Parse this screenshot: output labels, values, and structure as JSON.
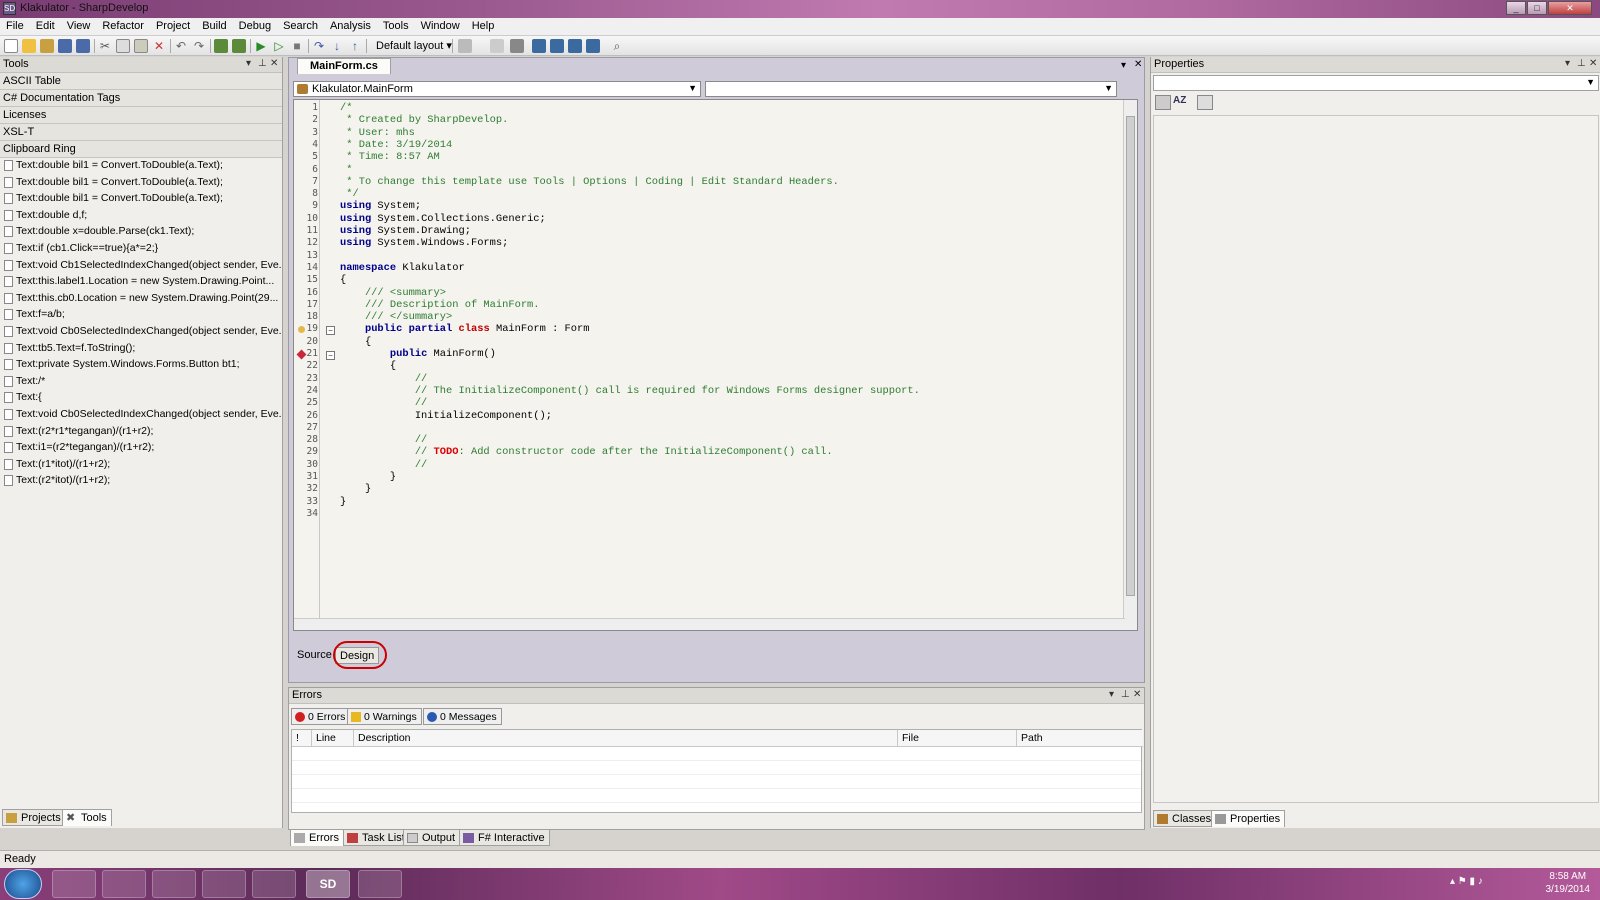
{
  "window": {
    "title": "Klakulator - SharpDevelop"
  },
  "menu": [
    "File",
    "Edit",
    "View",
    "Refactor",
    "Project",
    "Build",
    "Debug",
    "Search",
    "Analysis",
    "Tools",
    "Window",
    "Help"
  ],
  "toolbar": {
    "layout_label": "Default layout"
  },
  "tools_panel": {
    "title": "Tools",
    "categories": [
      "ASCII Table",
      "C# Documentation Tags",
      "Licenses",
      "XSL-T",
      "Clipboard Ring"
    ],
    "clipboard_items": [
      "Text:double bil1 = Convert.ToDouble(a.Text);",
      "Text:double bil1 = Convert.ToDouble(a.Text);",
      "Text:double bil1 = Convert.ToDouble(a.Text);",
      "Text:double d,f;",
      "Text:double x=double.Parse(ck1.Text);",
      "Text:if (cb1.Click==true){a*=2;}",
      "Text:void Cb1SelectedIndexChanged(object sender, Eve...",
      "Text:this.label1.Location = new System.Drawing.Point...",
      "Text:this.cb0.Location = new System.Drawing.Point(29...",
      "Text:f=a/b;",
      "Text:void Cb0SelectedIndexChanged(object sender, Eve...",
      "Text:tb5.Text=f.ToString();",
      "Text:private System.Windows.Forms.Button bt1;",
      "Text:/*",
      "Text:{",
      "Text:void Cb0SelectedIndexChanged(object sender, Eve...",
      "Text:(r2*r1*tegangan)/(r1+r2);",
      "Text:i1=(r2*tegangan)/(r1+r2);",
      "Text:(r1*itot)/(r1+r2);",
      "Text:(r2*itot)/(r1+r2);"
    ],
    "tabs": [
      "Projects",
      "Tools"
    ]
  },
  "editor": {
    "tab": "MainForm.cs",
    "class_combo": "Klakulator.MainForm",
    "line_numbers": [
      "1",
      "2",
      "3",
      "4",
      "5",
      "6",
      "7",
      "8",
      "9",
      "10",
      "11",
      "12",
      "13",
      "14",
      "15",
      "16",
      "17",
      "18",
      "19",
      "20",
      "21",
      "22",
      "23",
      "24",
      "25",
      "26",
      "27",
      "28",
      "29",
      "30",
      "31",
      "32",
      "33",
      "34"
    ],
    "code": [
      "/*",
      " * Created by SharpDevelop.",
      " * User: mhs",
      " * Date: 3/19/2014",
      " * Time: 8:57 AM",
      " * ",
      " * To change this template use Tools | Options | Coding | Edit Standard Headers.",
      " */",
      "using System;",
      "using System.Collections.Generic;",
      "using System.Drawing;",
      "using System.Windows.Forms;",
      "",
      "namespace Klakulator",
      "{",
      "    /// <summary>",
      "    /// Description of MainForm.",
      "    /// </summary>",
      "    public partial class MainForm : Form",
      "    {",
      "        public MainForm()",
      "        {",
      "            //",
      "            // The InitializeComponent() call is required for Windows Forms designer support.",
      "            //",
      "            InitializeComponent();",
      "            ",
      "            //",
      "            // TODO: Add constructor code after the InitializeComponent() call.",
      "            //",
      "        }",
      "    }",
      "}",
      ""
    ],
    "view_tabs": {
      "source": "Source",
      "design": "Design"
    }
  },
  "errors_panel": {
    "title": "Errors",
    "filters": {
      "errors": "0 Errors",
      "warnings": "0 Warnings",
      "messages": "0 Messages"
    },
    "columns": [
      "!",
      "Line",
      "Description",
      "File",
      "Path"
    ],
    "tabs": [
      "Errors",
      "Task List",
      "Output",
      "F# Interactive"
    ]
  },
  "properties_panel": {
    "title": "Properties",
    "tabs": [
      "Classes",
      "Properties"
    ]
  },
  "status": {
    "text": "Ready"
  },
  "taskbar": {
    "time": "8:58 AM",
    "date": "3/19/2014",
    "sd_label": "SD"
  },
  "colors": {
    "keyword": "#00008b",
    "comment": "#2e7d32",
    "todo": "#dd0000",
    "highlight_ring": "#cc0000"
  }
}
